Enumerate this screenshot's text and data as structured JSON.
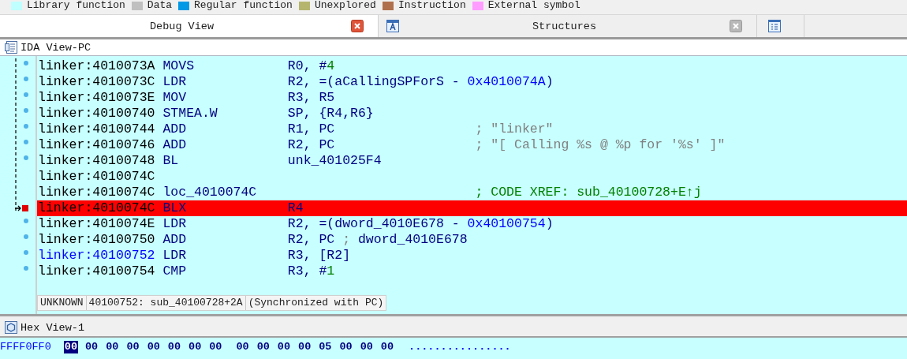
{
  "legend": [
    {
      "label": "Library function",
      "color": "#c0ffff"
    },
    {
      "label": "Data",
      "color": "#c0c0c0"
    },
    {
      "label": "Regular function",
      "color": "#0099e6"
    },
    {
      "label": "Unexplored",
      "color": "#b5b56e"
    },
    {
      "label": "Instruction",
      "color": "#b0704d"
    },
    {
      "label": "External symbol",
      "color": "#ff9cff"
    }
  ],
  "tabs": [
    {
      "kind": "plain",
      "label": "Debug View",
      "selected": true
    },
    {
      "kind": "structures",
      "label": "Structures",
      "selected": false
    },
    {
      "kind": "enums",
      "selected": false
    }
  ],
  "ida_view": {
    "title": "IDA View-PC",
    "rows": [
      {
        "address": "linker:4010073A",
        "mnemonic": "MOVS",
        "operands": [
          {
            "text": "R0, #",
            "kind": "reg"
          },
          {
            "text": "4",
            "kind": "num"
          }
        ],
        "dot": true,
        "highlighted": false,
        "selected": false,
        "breakpoint": false
      },
      {
        "address": "linker:4010073C",
        "mnemonic": "LDR",
        "operands": [
          {
            "text": "R2, =(aCallingSPForS - ",
            "kind": "reg"
          },
          {
            "text": "0x4010074A",
            "kind": "hex"
          },
          {
            "text": ")",
            "kind": "reg"
          }
        ],
        "dot": true,
        "highlighted": false,
        "selected": false,
        "breakpoint": false
      },
      {
        "address": "linker:4010073E",
        "mnemonic": "MOV",
        "operands": [
          {
            "text": "R3, R5",
            "kind": "reg"
          }
        ],
        "dot": true,
        "highlighted": false,
        "selected": false,
        "breakpoint": false
      },
      {
        "address": "linker:40100740",
        "mnemonic": "STMEA.W",
        "operands": [
          {
            "text": "SP, {R4,R6}",
            "kind": "reg"
          }
        ],
        "dot": true,
        "highlighted": false,
        "selected": false,
        "breakpoint": false
      },
      {
        "address": "linker:40100744",
        "mnemonic": "ADD",
        "operands": [
          {
            "text": "R1, PC",
            "kind": "reg"
          }
        ],
        "comment": {
          "text": "; \"linker\"",
          "kind": "string"
        },
        "dot": true,
        "highlighted": false,
        "selected": false,
        "breakpoint": false
      },
      {
        "address": "linker:40100746",
        "mnemonic": "ADD",
        "operands": [
          {
            "text": "R2, PC",
            "kind": "reg"
          }
        ],
        "comment": {
          "text": "; \"[ Calling %s @ %p for '%s' ]\"",
          "kind": "string"
        },
        "dot": true,
        "highlighted": false,
        "selected": false,
        "breakpoint": false
      },
      {
        "address": "linker:40100748",
        "mnemonic": "BL",
        "operands": [
          {
            "text": "unk_401025F4",
            "kind": "reg"
          }
        ],
        "dot": true,
        "highlighted": false,
        "selected": false,
        "breakpoint": false
      },
      {
        "address": "linker:4010074C",
        "dot": false,
        "highlighted": false,
        "selected": false,
        "breakpoint": false
      },
      {
        "address": "linker:4010074C",
        "mnemonic": "loc_4010074C",
        "comment": {
          "text": "; CODE XREF: sub_40100728+E↑j",
          "kind": "xref"
        },
        "dot": false,
        "highlighted": false,
        "selected": false,
        "breakpoint": false
      },
      {
        "address": "linker:4010074C",
        "mnemonic": "BLX",
        "operands": [
          {
            "text": "R4",
            "kind": "reg"
          }
        ],
        "dot": false,
        "highlighted": true,
        "selected": false,
        "breakpoint": true
      },
      {
        "address": "linker:4010074E",
        "mnemonic": "LDR",
        "operands": [
          {
            "text": "R2, =(dword_4010E678 - ",
            "kind": "reg"
          },
          {
            "text": "0x40100754",
            "kind": "hex"
          },
          {
            "text": ")",
            "kind": "reg"
          }
        ],
        "dot": true,
        "highlighted": false,
        "selected": false,
        "breakpoint": false
      },
      {
        "address": "linker:40100750",
        "mnemonic": "ADD",
        "operands": [
          {
            "text": "R2, PC ",
            "kind": "reg"
          },
          {
            "text": "; ",
            "kind": "punct"
          },
          {
            "text": "dword_4010E678",
            "kind": "reg"
          }
        ],
        "dot": true,
        "highlighted": false,
        "selected": false,
        "breakpoint": false
      },
      {
        "address": "linker:40100752",
        "mnemonic": "LDR",
        "operands": [
          {
            "text": "R3, ",
            "kind": "reg"
          },
          {
            "text": "[R2]",
            "kind": "reg"
          }
        ],
        "dot": true,
        "highlighted": false,
        "selected": true,
        "breakpoint": false
      },
      {
        "address": "linker:40100754",
        "mnemonic": "CMP",
        "operands": [
          {
            "text": "R3, #",
            "kind": "reg"
          },
          {
            "text": "1",
            "kind": "num"
          }
        ],
        "dot": true,
        "highlighted": false,
        "selected": false,
        "breakpoint": false
      }
    ],
    "status": [
      "UNKNOWN",
      "40100752: sub_40100728+2A",
      "(Synchronized with PC)"
    ]
  },
  "hex_view": {
    "title": "Hex View-1",
    "address": "FFFF0FF0",
    "bytes": [
      {
        "text": "00",
        "selected": true
      },
      {
        "text": "00",
        "selected": false
      },
      {
        "text": "00",
        "selected": false
      },
      {
        "text": "00",
        "selected": false
      },
      {
        "text": "00",
        "selected": false
      },
      {
        "text": "00",
        "selected": false
      },
      {
        "text": "00",
        "selected": false
      },
      {
        "text": "00",
        "selected": false
      },
      {
        "text": "00",
        "selected": false
      },
      {
        "text": "00",
        "selected": false
      },
      {
        "text": "00",
        "selected": false
      },
      {
        "text": "00",
        "selected": false
      },
      {
        "text": "05",
        "selected": false
      },
      {
        "text": "00",
        "selected": false
      },
      {
        "text": "00",
        "selected": false
      },
      {
        "text": "00",
        "selected": false
      }
    ],
    "ascii": "................"
  }
}
